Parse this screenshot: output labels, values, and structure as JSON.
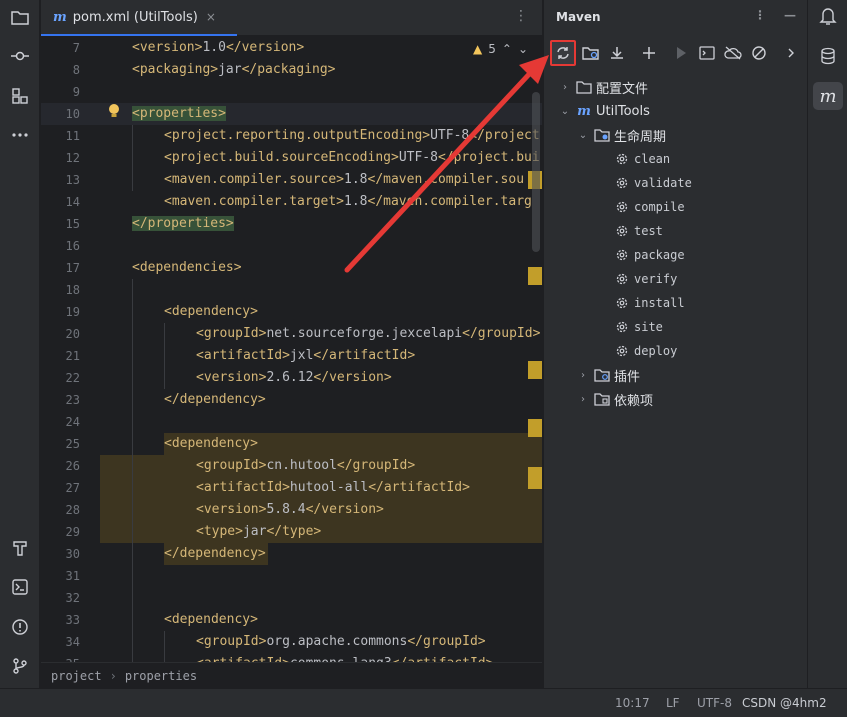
{
  "editor": {
    "tab_title": "pom.xml (UtilTools)",
    "tab_icon_letter": "m",
    "tab_close": "×",
    "more_glyph": "⋮",
    "warning_count": "5",
    "lines": [
      {
        "n": "7",
        "indent": 1,
        "tag_open": "<version>",
        "text": "1.0",
        "tag_close": "</version>"
      },
      {
        "n": "8",
        "indent": 1,
        "tag_open": "<packaging>",
        "text": "jar",
        "tag_close": "</packaging>"
      },
      {
        "n": "9",
        "indent": 0,
        "tag_open": "",
        "text": "",
        "tag_close": ""
      },
      {
        "n": "10",
        "indent": 1,
        "tag_open": "<properties>",
        "text": "",
        "tag_close": ""
      },
      {
        "n": "11",
        "indent": 2,
        "tag_open": "<project.reporting.outputEncoding>",
        "text": "UTF-8",
        "tag_close": "</project"
      },
      {
        "n": "12",
        "indent": 2,
        "tag_open": "<project.build.sourceEncoding>",
        "text": "UTF-8",
        "tag_close": "</project.bui"
      },
      {
        "n": "13",
        "indent": 2,
        "tag_open": "<maven.compiler.source>",
        "text": "1.8",
        "tag_close": "</maven.compiler.sou"
      },
      {
        "n": "14",
        "indent": 2,
        "tag_open": "<maven.compiler.target>",
        "text": "1.8",
        "tag_close": "</maven.compiler.targ"
      },
      {
        "n": "15",
        "indent": 1,
        "tag_open": "</properties>",
        "text": "",
        "tag_close": ""
      },
      {
        "n": "16",
        "indent": 0,
        "tag_open": "",
        "text": "",
        "tag_close": ""
      },
      {
        "n": "17",
        "indent": 1,
        "tag_open": "<dependencies>",
        "text": "",
        "tag_close": ""
      },
      {
        "n": "18",
        "indent": 0,
        "tag_open": "",
        "text": "",
        "tag_close": ""
      },
      {
        "n": "19",
        "indent": 2,
        "tag_open": "<dependency>",
        "text": "",
        "tag_close": ""
      },
      {
        "n": "20",
        "indent": 3,
        "tag_open": "<groupId>",
        "text": "net.sourceforge.jexcelapi",
        "tag_close": "</groupId>"
      },
      {
        "n": "21",
        "indent": 3,
        "tag_open": "<artifactId>",
        "text": "jxl",
        "tag_close": "</artifactId>"
      },
      {
        "n": "22",
        "indent": 3,
        "tag_open": "<version>",
        "text": "2.6.12",
        "tag_close": "</version>"
      },
      {
        "n": "23",
        "indent": 2,
        "tag_open": "</dependency>",
        "text": "",
        "tag_close": ""
      },
      {
        "n": "24",
        "indent": 0,
        "tag_open": "",
        "text": "",
        "tag_close": ""
      },
      {
        "n": "25",
        "indent": 2,
        "tag_open": "<dependency>",
        "text": "",
        "tag_close": ""
      },
      {
        "n": "26",
        "indent": 3,
        "tag_open": "<groupId>",
        "text": "cn.hutool",
        "tag_close": "</groupId>"
      },
      {
        "n": "27",
        "indent": 3,
        "tag_open": "<artifactId>",
        "text": "hutool-all",
        "tag_close": "</artifactId>"
      },
      {
        "n": "28",
        "indent": 3,
        "tag_open": "<version>",
        "text": "5.8.4",
        "tag_close": "</version>"
      },
      {
        "n": "29",
        "indent": 3,
        "tag_open": "<type>",
        "text": "jar",
        "tag_close": "</type>"
      },
      {
        "n": "30",
        "indent": 2,
        "tag_open": "</dependency>",
        "text": "",
        "tag_close": ""
      },
      {
        "n": "31",
        "indent": 0,
        "tag_open": "",
        "text": "",
        "tag_close": ""
      },
      {
        "n": "32",
        "indent": 0,
        "tag_open": "",
        "text": "",
        "tag_close": ""
      },
      {
        "n": "33",
        "indent": 2,
        "tag_open": "<dependency>",
        "text": "",
        "tag_close": ""
      },
      {
        "n": "34",
        "indent": 3,
        "tag_open": "<groupId>",
        "text": "org.apache.commons",
        "tag_close": "</groupId>"
      },
      {
        "n": "35",
        "indent": 3,
        "tag_open": "<artifactId>",
        "text": "commons-lang3",
        "tag_close": "</artifactId>"
      }
    ],
    "breadcrumb": [
      "project",
      "properties"
    ]
  },
  "maven": {
    "title": "Maven",
    "tree": {
      "config": "配置文件",
      "project": "UtilTools",
      "lifecycle": "生命周期",
      "goals": [
        "clean",
        "validate",
        "compile",
        "test",
        "package",
        "verify",
        "install",
        "site",
        "deploy"
      ],
      "plugins": "插件",
      "dependencies": "依赖项"
    }
  },
  "statusbar": {
    "position": "10:17",
    "line_sep": "LF",
    "encoding": "UTF-8",
    "watermark": "CSDN @4hm2"
  },
  "colors": {
    "accent": "#3574f0",
    "highlight_red": "#e53935",
    "tag": "#d5b778"
  }
}
